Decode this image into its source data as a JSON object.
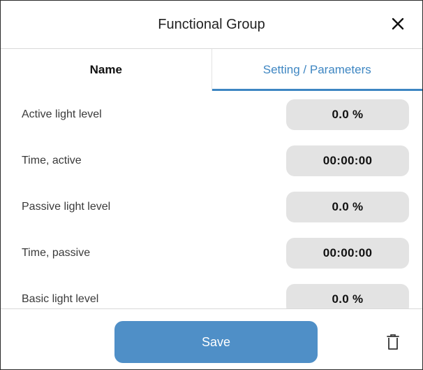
{
  "header": {
    "title": "Functional Group",
    "close_icon": "close-icon"
  },
  "tabs": [
    {
      "label": "Name",
      "active": false
    },
    {
      "label": "Setting / Parameters",
      "active": true
    }
  ],
  "parameters": [
    {
      "label": "Active light level",
      "value": "0.0 %"
    },
    {
      "label": "Time, active",
      "value": "00:00:00"
    },
    {
      "label": "Passive light level",
      "value": "0.0 %"
    },
    {
      "label": "Time, passive",
      "value": "00:00:00"
    },
    {
      "label": "Basic light level",
      "value": "0.0 %"
    }
  ],
  "footer": {
    "save_label": "Save",
    "delete_icon": "trash-icon"
  },
  "colors": {
    "accent": "#3e86c2",
    "save_button": "#4f8fc7",
    "value_pill": "#e3e3e3"
  }
}
